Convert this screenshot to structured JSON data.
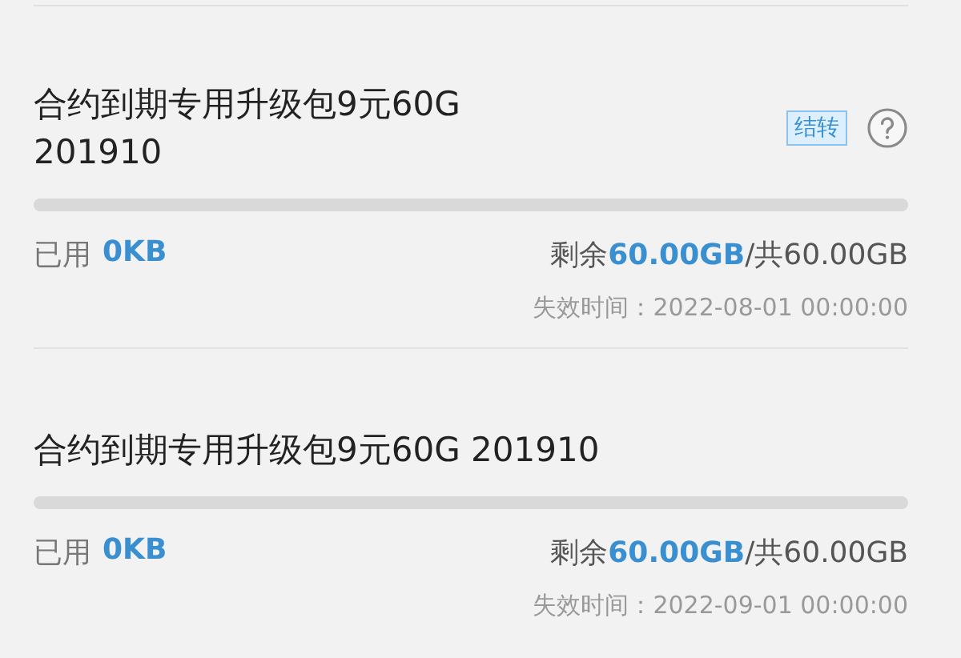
{
  "packages": [
    {
      "title": "合约到期专用升级包9元60G 201910",
      "tag": "结转",
      "help": true,
      "level": 0,
      "used_label": "已用",
      "used_value": "0KB",
      "remaining": "剩余**60.00GB**/共60.00GB",
      "expiry": "失效时间：2022-08-01 00:00:00"
    },
    {
      "title": "合约到期专用升级包9元60G 201910",
      "help": false,
      "level": 0,
      "used_label": "已用",
      "used_value": "0KB",
      "remaining": "剩余**60.00GB**/共60.00GB",
      "expiry": "失效时间：2022-09-01 00:00:00"
    }
  ]
}
